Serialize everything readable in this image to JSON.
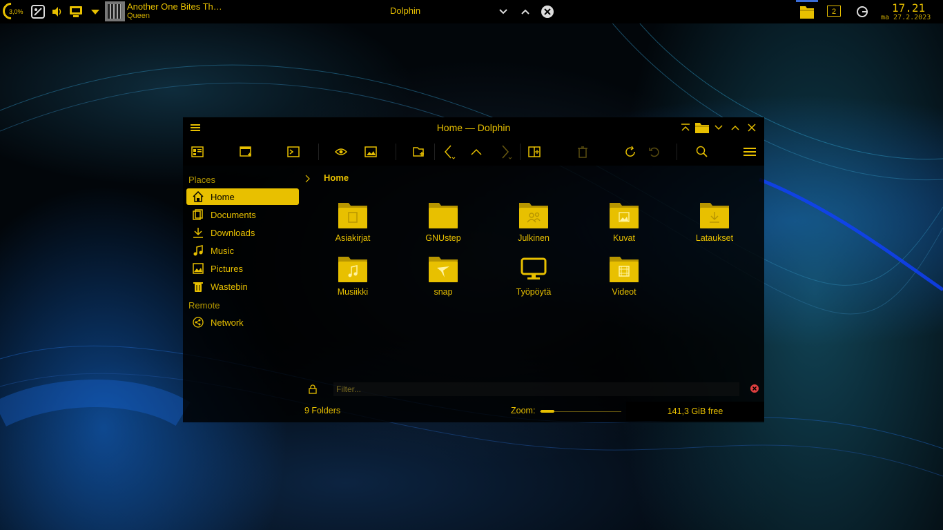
{
  "panel": {
    "cpu_percent": "3,0%",
    "media_title": "Another One Bites Th…",
    "media_artist": "Queen",
    "active_window_title": "Dolphin",
    "virtual_desktop": "2",
    "clock_time": "17.21",
    "clock_date": "ma 27.2.2023"
  },
  "window": {
    "title": "Home — Dolphin",
    "breadcrumb": "Home",
    "places_header": "Places",
    "remote_header": "Remote",
    "places": [
      {
        "label": "Home",
        "icon": "home-icon"
      },
      {
        "label": "Documents",
        "icon": "documents-icon"
      },
      {
        "label": "Downloads",
        "icon": "downloads-icon"
      },
      {
        "label": "Music",
        "icon": "music-icon"
      },
      {
        "label": "Pictures",
        "icon": "pictures-icon"
      },
      {
        "label": "Wastebin",
        "icon": "wastebin-icon"
      }
    ],
    "remote": [
      {
        "label": "Network",
        "icon": "network-icon"
      }
    ],
    "items": [
      {
        "label": "Asiakirjat",
        "icon": "folder-documents-icon"
      },
      {
        "label": "GNUstep",
        "icon": "folder-icon"
      },
      {
        "label": "Julkinen",
        "icon": "folder-public-icon"
      },
      {
        "label": "Kuvat",
        "icon": "folder-pictures-icon"
      },
      {
        "label": "Lataukset",
        "icon": "folder-downloads-icon"
      },
      {
        "label": "Musiikki",
        "icon": "folder-music-icon"
      },
      {
        "label": "snap",
        "icon": "folder-snap-icon"
      },
      {
        "label": "Työpöytä",
        "icon": "desktop-icon"
      },
      {
        "label": "Videot",
        "icon": "folder-videos-icon"
      }
    ],
    "filter_placeholder": "Filter...",
    "status_count": "9 Folders",
    "zoom_label": "Zoom:",
    "zoom_level": 0.1,
    "free_space": "141,3 GiB free"
  },
  "colors": {
    "accent": "#e8c000",
    "background": "#000000",
    "folder": "#e8c000",
    "folder_dark": "#b89600"
  }
}
